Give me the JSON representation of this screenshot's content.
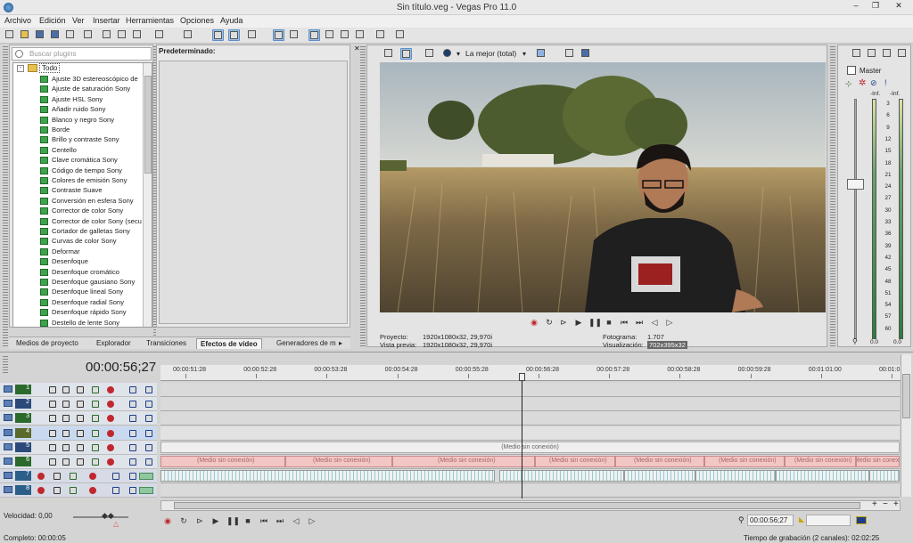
{
  "window": {
    "title": "Sin título.veg - Vegas Pro 11.0",
    "minimize": "–",
    "restore": "❐",
    "close": "✕"
  },
  "menu": [
    "Archivo",
    "Edición",
    "Ver",
    "Insertar",
    "Herramientas",
    "Opciones",
    "Ayuda"
  ],
  "plugins": {
    "search_placeholder": "Buscar plugins",
    "root": "Todo",
    "items": [
      "Ajuste 3D estereoscópico de",
      "Ajuste de saturación Sony",
      "Ajuste HSL Sony",
      "Añadir ruido Sony",
      "Blanco y negro Sony",
      "Borde",
      "Brillo y contraste Sony",
      "Centello",
      "Clave cromática Sony",
      "Código de tiempo Sony",
      "Colores de emisión Sony",
      "Contraste Suave",
      "Conversión en esfera Sony",
      "Corrector de color Sony",
      "Corrector de color Sony (secu",
      "Cortador de galletas Sony",
      "Curvas de color Sony",
      "Deformar",
      "Desenfoque",
      "Desenfoque cromático",
      "Desenfoque gausiano Sony",
      "Desenfoque lineal Sony",
      "Desenfoque radial Sony",
      "Desenfoque rápido Sony",
      "Destello de lente Sony"
    ],
    "presets_header": "Predeterminado:"
  },
  "tabs": [
    "Medios de proyecto",
    "Explorador",
    "Transiciones",
    "Efectos de vídeo",
    "Generadores de m"
  ],
  "preview": {
    "quality": "La mejor (total)",
    "proyecto_label": "Proyecto:",
    "proyecto_value": "1920x1080x32, 29,970i",
    "vista_label": "Vista previa:",
    "vista_value": "1920x1080x32, 29,970i",
    "fotograma_label": "Fotograma:",
    "fotograma_value": "1.707",
    "visualizacion_label": "Visualización:",
    "visualizacion_value": "702x395x32"
  },
  "master": {
    "label": "Master",
    "inf_left": "-Inf.",
    "inf_right": "-Inf.",
    "scale": [
      "3",
      "6",
      "9",
      "12",
      "15",
      "18",
      "21",
      "24",
      "27",
      "30",
      "33",
      "36",
      "39",
      "42",
      "45",
      "48",
      "51",
      "54",
      "57",
      "60"
    ],
    "val_left": "0.0",
    "val_right": "0.0"
  },
  "timeline": {
    "timecode": "00:00:56;27",
    "ruler": [
      "00:00:51:28",
      "00:00:52:28",
      "00:00:53:28",
      "00:00:54:28",
      "00:00:55:28",
      "00:00:56:28",
      "00:00:57:28",
      "00:00:58:28",
      "00:00:59:28",
      "00:01:01:00",
      "00:01:0"
    ],
    "tracks": [
      "1",
      "2",
      "3",
      "4",
      "5",
      "6",
      "7",
      "8"
    ],
    "offline_label": "(Medio sin conexión)",
    "offline_short": "(Medio sin conexión)",
    "velocidad": "Velocidad: 0,00",
    "completo": "Completo: 00:00:05",
    "cursor_time": "00:00:56;27",
    "grabacion": "Tiempo de grabación (2 canales): 02:02:25"
  },
  "colors": {
    "accent": "#5b8fc5",
    "track_video": "#2c6a2c",
    "clip_pink": "#f3c6c6",
    "clip_gray": "#efefef"
  }
}
